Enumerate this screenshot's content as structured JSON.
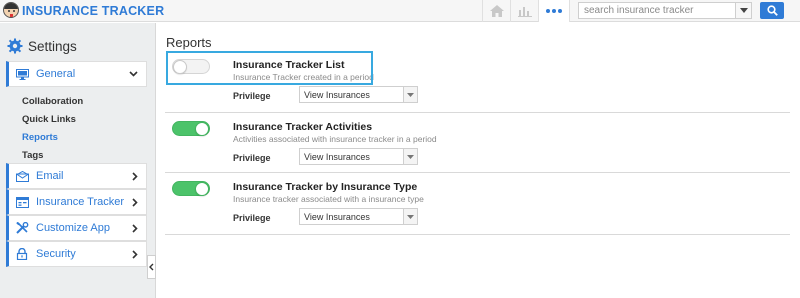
{
  "app": {
    "title": "INSURANCE TRACKER"
  },
  "search": {
    "placeholder": "search insurance tracker"
  },
  "sidebar": {
    "heading": "Settings",
    "sections": [
      {
        "label": "General",
        "icon": "monitor-icon"
      },
      {
        "label": "Email",
        "icon": "envelope-icon"
      },
      {
        "label": "Insurance Tracker",
        "icon": "tracker-icon"
      },
      {
        "label": "Customize App",
        "icon": "tools-icon"
      },
      {
        "label": "Security",
        "icon": "lock-icon"
      }
    ],
    "sub_items": [
      {
        "label": "Collaboration",
        "active": false
      },
      {
        "label": "Quick Links",
        "active": false
      },
      {
        "label": "Reports",
        "active": true
      },
      {
        "label": "Tags",
        "active": false
      }
    ]
  },
  "main": {
    "title": "Reports",
    "privilege_label": "Privilege",
    "reports": [
      {
        "name": "Insurance Tracker List",
        "description": "Insurance Tracker created in a period",
        "enabled": false,
        "privilege": "View Insurances"
      },
      {
        "name": "Insurance Tracker Activities",
        "description": "Activities associated with insurance tracker in a period",
        "enabled": true,
        "privilege": "View Insurances"
      },
      {
        "name": "Insurance Tracker by Insurance Type",
        "description": "Insurance tracker associated with a insurance type",
        "enabled": true,
        "privilege": "View Insurances"
      }
    ]
  },
  "colors": {
    "accent": "#2f7bd6",
    "toggle_on": "#4cc36a",
    "highlight": "#38a9e0"
  }
}
